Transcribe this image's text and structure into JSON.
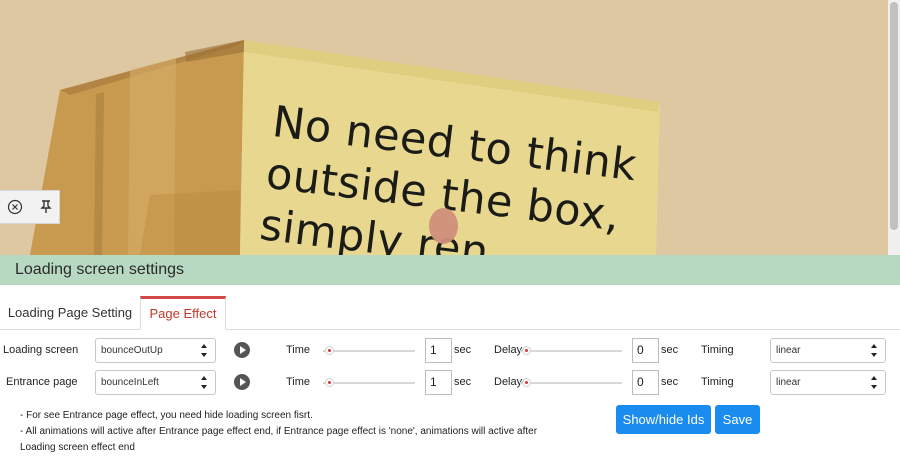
{
  "preview": {
    "box_text": [
      "No need to think",
      "outside the box,",
      "simply ren..."
    ],
    "toolbar": {
      "close_icon": "circle-x",
      "pin_icon": "pin-down"
    }
  },
  "settings": {
    "title": "Loading screen settings",
    "tabs": [
      {
        "label": "Loading Page Setting",
        "active": false
      },
      {
        "label": "Page Effect",
        "active": true
      }
    ],
    "rows": [
      {
        "label": "Loading screen",
        "animation": "bounceOutUp",
        "time_label": "Time",
        "time_value": "1",
        "time_unit": "sec",
        "delay_label": "Delay",
        "delay_value": "0",
        "delay_unit": "sec",
        "timing_label": "Timing",
        "timing_value": "linear"
      },
      {
        "label": "Entrance page",
        "animation": "bounceInLeft",
        "time_label": "Time",
        "time_value": "1",
        "time_unit": "sec",
        "delay_label": "Delay",
        "delay_value": "0",
        "delay_unit": "sec",
        "timing_label": "Timing",
        "timing_value": "linear"
      }
    ],
    "notes": [
      "- For see Entrance page effect, you need hide loading screen fisrt.",
      "- All animations will active after Entrance page effect end, if Entrance page effect is 'none', animations will active after",
      "Loading screen effect end"
    ],
    "buttons": {
      "show_hide": "Show/hide Ids",
      "save": "Save"
    },
    "colors": {
      "header_bg": "#b7d9c2",
      "active_tab": "#c0392b",
      "primary_button": "#1a8cf0",
      "preview_bg": "#ddc8a2"
    }
  }
}
